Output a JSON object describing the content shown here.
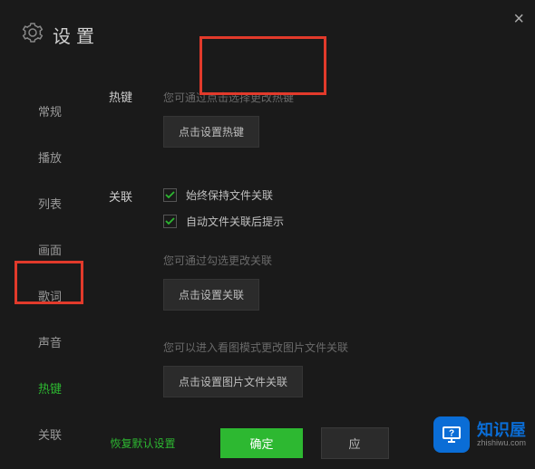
{
  "title": "设置",
  "close": "×",
  "sidebar": {
    "items": [
      {
        "label": "常规"
      },
      {
        "label": "播放"
      },
      {
        "label": "列表"
      },
      {
        "label": "画面"
      },
      {
        "label": "歌词"
      },
      {
        "label": "声音"
      },
      {
        "label": "热键"
      },
      {
        "label": "关联"
      }
    ]
  },
  "hotkey": {
    "title": "热键",
    "hint": "您可通过点击选择更改热键",
    "button": "点击设置热键"
  },
  "assoc": {
    "title": "关联",
    "chk1": "始终保持文件关联",
    "chk2": "自动文件关联后提示",
    "hint2": "您可通过勾选更改关联",
    "button2": "点击设置关联",
    "hint3": "您可以进入看图模式更改图片文件关联",
    "button3": "点击设置图片文件关联"
  },
  "footer": {
    "restore": "恢复默认设置",
    "ok": "确定",
    "apply": "应"
  },
  "branding": {
    "name": "知识屋",
    "domain": "zhishiwu.com"
  }
}
